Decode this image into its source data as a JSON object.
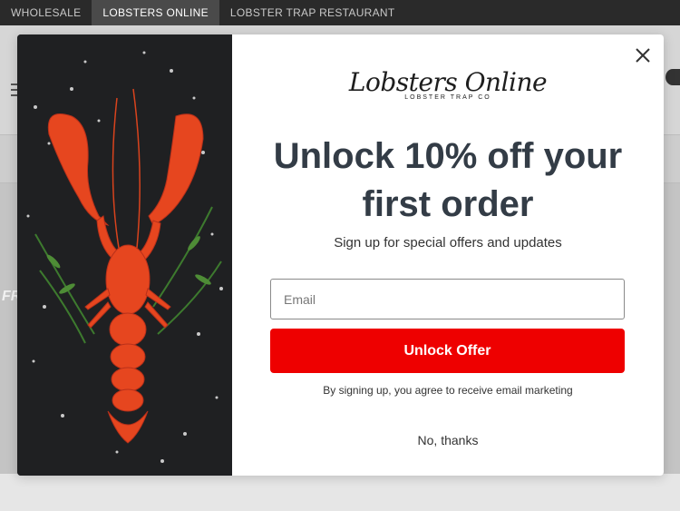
{
  "top_nav": {
    "items": [
      {
        "label": "WHOLESALE",
        "active": false
      },
      {
        "label": "LOBSTERS ONLINE",
        "active": true
      },
      {
        "label": "LOBSTER TRAP RESTAURANT",
        "active": false
      }
    ]
  },
  "background_page": {
    "hero_text": "FR"
  },
  "modal": {
    "brand": {
      "name": "Lobsters Online",
      "subtitle": "LOBSTER TRAP CO"
    },
    "headline_line1": "Unlock 10% off your",
    "headline_line2": "first order",
    "subline": "Sign up for special offers and updates",
    "email": {
      "value": "",
      "placeholder": "Email"
    },
    "submit_label": "Unlock Offer",
    "disclaimer": "By signing up, you agree to receive email marketing",
    "decline_label": "No, thanks",
    "image_icon": "lobster-image"
  },
  "colors": {
    "accent_button": "#ee0000",
    "headline": "#333c46",
    "topbar": "#2a2a2a"
  }
}
